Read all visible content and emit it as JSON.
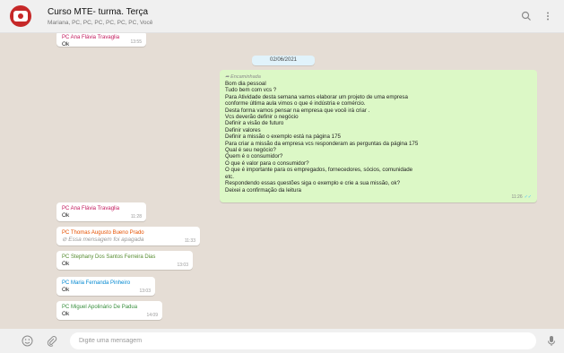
{
  "header": {
    "title": "Curso MTE- turma. Terça",
    "members": "Mariana, PC, PC, PC, PC, PC, PC, Você",
    "search_icon": "search-icon",
    "menu_icon": "kebab-menu-icon"
  },
  "colors": {
    "chat_background": "#e5ddd5",
    "outgoing_bubble": "#dcf8c6",
    "incoming_bubble": "#ffffff"
  },
  "messages_top": {
    "sender": "PC Ana Flávia Travaglia",
    "sender_color": "#c2185b",
    "text": "Ok",
    "time": "13:55"
  },
  "date_chip": "02/06/2021",
  "forwarded": {
    "label": "Encaminhada",
    "lines": [
      "Bom dia pessoal",
      "Tudo bem com vcs ?",
      "Para Atividade desta semana vamos elaborar um projeto de uma empresa",
      "conforme  última aula vimos o que é indústria e comércio.",
      "Desta forma vamos pensar na empresa que você irá criar .",
      "Vcs deverão definir o negócio",
      "Definir a visão de futuro",
      "Definir valores",
      "Definir a missão o exemplo está na página 175",
      "Para  criar a missão da empresa  vcs responderam as perguntas da página 175",
      "Qual é seu negócio?",
      "Quem é o consumidor?",
      "O que é valor para o consumidor?",
      "O que é importante para os empregados, fornecedores, sócios, comunidade",
      "etc.",
      "Respondendo essas questões siga o exemplo e crie a sua missão, ok?",
      "Deixei a confirmação da leitura"
    ],
    "time": "11:26",
    "status": "read"
  },
  "messages": [
    {
      "sender": "PC Ana Flávia Travaglia",
      "sender_color": "#c2185b",
      "text": "Ok",
      "time": "11:28",
      "deleted": false
    },
    {
      "sender": "PC Thomas Augusto Bueno Prado",
      "sender_color": "#e65100",
      "text": "Essa mensagem foi apagada",
      "time": "11:33",
      "deleted": true
    },
    {
      "sender": "PC Stephany Dos Santos Ferreira Dias",
      "sender_color": "#558b2f",
      "text": "Ok",
      "time": "13:03",
      "deleted": false
    },
    {
      "sender": "PC Maria Fernanda Pinheiro",
      "sender_color": "#0288d1",
      "text": "Ok",
      "time": "13:03",
      "deleted": false
    },
    {
      "sender": "PC Miguel Apolinário De Padua",
      "sender_color": "#388e3c",
      "text": "Ok",
      "time": "14:09",
      "deleted": false
    }
  ],
  "footer": {
    "placeholder": "Digite uma mensagem",
    "emoji_icon": "emoji-icon",
    "attach_icon": "paperclip-icon",
    "mic_icon": "microphone-icon"
  }
}
